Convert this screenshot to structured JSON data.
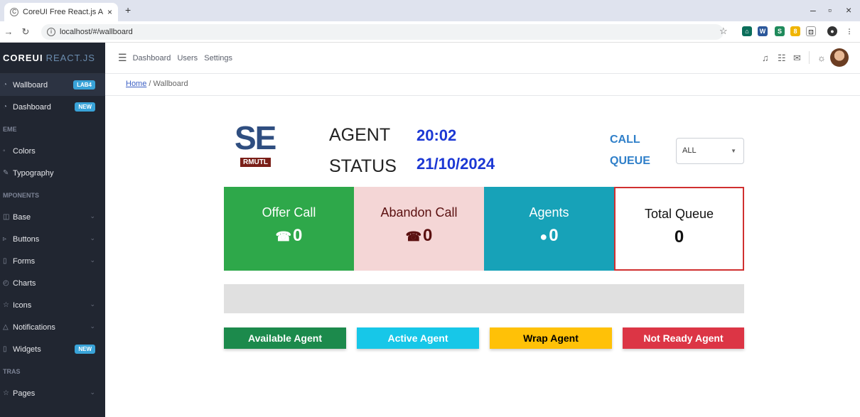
{
  "browser": {
    "tab_title": "CoreUI Free React.js Admin Tem",
    "tab_close": "×",
    "new_tab": "+",
    "url": "localhost/#/wallboard",
    "win_min": "–",
    "win_max": "▫",
    "win_close": "×"
  },
  "sidebar": {
    "brand_core": "COREUI",
    "brand_react": "REACT.JS",
    "items": [
      {
        "label": "Wallboard",
        "badge": "LAB4",
        "badge_color": "#39a3d8"
      },
      {
        "label": "Dashboard",
        "badge": "NEW",
        "badge_color": "#39a3d8"
      },
      {
        "title": "EME"
      },
      {
        "label": "Colors"
      },
      {
        "label": "Typography"
      },
      {
        "title": "MPONENTS"
      },
      {
        "label": "Base",
        "chevron": true
      },
      {
        "label": "Buttons",
        "chevron": true
      },
      {
        "label": "Forms",
        "chevron": true
      },
      {
        "label": "Charts"
      },
      {
        "label": "Icons",
        "chevron": true
      },
      {
        "label": "Notifications",
        "chevron": true
      },
      {
        "label": "Widgets",
        "badge": "NEW",
        "badge_color": "#39a3d8"
      },
      {
        "title": "TRAS"
      },
      {
        "label": "Pages",
        "chevron": true
      }
    ]
  },
  "header": {
    "nav": [
      "Dashboard",
      "Users",
      "Settings"
    ]
  },
  "breadcrumb": {
    "home": "Home",
    "sep": "/",
    "current": "Wallboard"
  },
  "wallboard": {
    "logo_se": "SE",
    "logo_rmutl": "RMUTL",
    "agent_label": "AGENT",
    "status_label": "STATUS",
    "time": "20:02",
    "date": "21/10/2024",
    "call_label": "CALL",
    "queue_label": "QUEUE",
    "queue_select": "ALL",
    "cards": [
      {
        "title": "Offer Call",
        "value": "0",
        "icon": "phone-incoming-icon",
        "bg": "#2ea84a",
        "color": "#ffffff"
      },
      {
        "title": "Abandon Call",
        "value": "0",
        "icon": "phone-missed-icon",
        "bg": "#f4d6d6",
        "color": "#5a1010"
      },
      {
        "title": "Agents",
        "value": "0",
        "icon": "user-voice-icon",
        "bg": "#17a2b8",
        "color": "#ffffff"
      },
      {
        "title": "Total Queue",
        "value": "0",
        "bg": "#ffffff",
        "color": "#111111"
      }
    ],
    "legend": [
      {
        "label": "Available Agent",
        "color": "#1c8a4c"
      },
      {
        "label": "Active Agent",
        "color": "#17c7e8"
      },
      {
        "label": "Wrap Agent",
        "color": "#ffc107"
      },
      {
        "label": "Not Ready Agent",
        "color": "#dc3545"
      }
    ]
  }
}
